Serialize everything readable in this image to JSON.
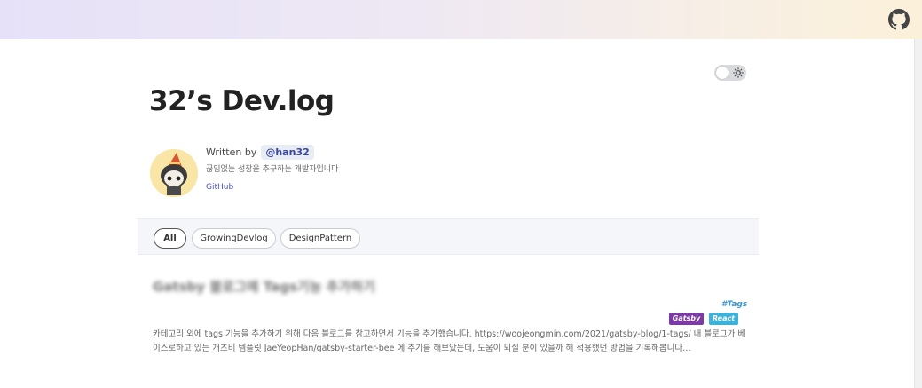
{
  "header": {
    "github_icon": "github-icon",
    "gradient_colors": [
      "#e6e1f8",
      "#fbf0d9"
    ]
  },
  "theme_toggle": {
    "icon": "sun-icon",
    "state": "light"
  },
  "blog": {
    "title": "32’s Dev.log"
  },
  "bio": {
    "written_by_label": "Written by",
    "author": "@han32",
    "description": "끊임없는 성장을 추구하는 개발자입니다",
    "github_link": "GitHub"
  },
  "categories": {
    "items": [
      "All",
      "GrowingDevlog",
      "DesignPattern"
    ],
    "selected": "All"
  },
  "post": {
    "title": "Gatsby 블로그에 Tags기능 추가하기",
    "tag_name": "#Tags",
    "tags": [
      "Gatsby",
      "React"
    ],
    "excerpt": "카테고리 외에 tags 기능을 추가하기 위해 다음 블로그를 참고하면서 기능을 추가했습니다. https://woojeongmin.com/2021/gatsby-blog/1-tags/ 내 블로그가 베이스로하고 있는 개츠비 템플릿 JaeYeopHan/gatsby-starter-bee 에 추가를 해보았는데, 도움이 되실 분이 있을까 해 적용했던 방법을 기록해봅니다…"
  },
  "colors": {
    "accent": "#3a47a0",
    "tag_gatsby": "#7c3aa5",
    "tag_react": "#3cb1da",
    "tag_label": "#3b93d1"
  }
}
